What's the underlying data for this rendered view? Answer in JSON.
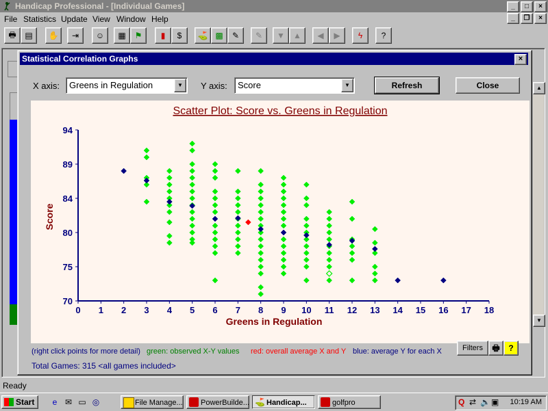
{
  "window": {
    "title": "Handicap Professional - [Individual Games]",
    "menu": [
      "File",
      "Statistics",
      "Update",
      "View",
      "Window",
      "Help"
    ],
    "toolbar_icons": [
      "printer-icon",
      "document-icon",
      "stop-hand-icon",
      "exit-icon",
      "handshake-icon",
      "calculator-icon",
      "flag-icon",
      "bar-chart-icon",
      "dollar-icon",
      "golfer-icon",
      "map-icon",
      "edit-icon",
      "disabled-icon",
      "down-arrow-icon",
      "up-arrow-icon",
      "left-arrow-icon",
      "right-arrow-icon",
      "lightning-icon",
      "help-icon"
    ]
  },
  "dialog": {
    "title": "Statistical Correlation Graphs",
    "x_axis_label": "X axis:",
    "x_axis_value": "Greens in Regulation",
    "y_axis_label": "Y axis:",
    "y_axis_value": "Score",
    "refresh_label": "Refresh",
    "close_label": "Close",
    "legend_hint": "(right click points for more detail)",
    "legend_green": "green: observed X-Y values",
    "legend_red": "red: overall average X and Y",
    "legend_blue": "blue: average Y for each X",
    "filters_label": "Filters",
    "total_games": "Total Games: 315  <all games included>"
  },
  "status_text": "Ready",
  "taskbar": {
    "start_label": "Start",
    "tasks": [
      "File Manage...",
      "PowerBuilde...",
      "Handicap...",
      "golfpro"
    ],
    "clock": "10:19 AM"
  },
  "colors": {
    "observed": "#00ee00",
    "overall_average": "#ff0000",
    "average_per_x": "#000080",
    "title": "#800000",
    "axis": "#000080"
  },
  "chart_data": {
    "type": "scatter",
    "title": "Scatter Plot: Score vs. Greens in Regulation",
    "xlabel": "Greens in Regulation",
    "ylabel": "Score",
    "xlim": [
      0,
      18
    ],
    "ylim": [
      70,
      94
    ],
    "x_ticks": [
      0,
      1,
      2,
      3,
      4,
      5,
      6,
      7,
      8,
      9,
      10,
      11,
      12,
      13,
      14,
      15,
      16,
      17,
      18
    ],
    "y_ticks": [
      70,
      75,
      80,
      84,
      89,
      94
    ],
    "y_tick_positions": [
      70,
      75,
      80,
      85,
      90,
      95
    ],
    "series": [
      {
        "name": "green: observed X-Y values",
        "points": [
          [
            3,
            92
          ],
          [
            3,
            91
          ],
          [
            3,
            88
          ],
          [
            3,
            87
          ],
          [
            3,
            84.5
          ],
          [
            4,
            89
          ],
          [
            4,
            88
          ],
          [
            4,
            87
          ],
          [
            4,
            86
          ],
          [
            4,
            85
          ],
          [
            4,
            84
          ],
          [
            4,
            83
          ],
          [
            4,
            81.5
          ],
          [
            4,
            79.5
          ],
          [
            4,
            78.5
          ],
          [
            5,
            93
          ],
          [
            5,
            92
          ],
          [
            5,
            90
          ],
          [
            5,
            89
          ],
          [
            5,
            88
          ],
          [
            5,
            87
          ],
          [
            5,
            86
          ],
          [
            5,
            85
          ],
          [
            5,
            84
          ],
          [
            5,
            83
          ],
          [
            5,
            82
          ],
          [
            5,
            81
          ],
          [
            5,
            80
          ],
          [
            5,
            79
          ],
          [
            5,
            78.5
          ],
          [
            6,
            90
          ],
          [
            6,
            89
          ],
          [
            6,
            88
          ],
          [
            6,
            86
          ],
          [
            6,
            85
          ],
          [
            6,
            84
          ],
          [
            6,
            83
          ],
          [
            6,
            81
          ],
          [
            6,
            80
          ],
          [
            6,
            79
          ],
          [
            6,
            78
          ],
          [
            6,
            77
          ],
          [
            6,
            73
          ],
          [
            7,
            89
          ],
          [
            7,
            86
          ],
          [
            7,
            85
          ],
          [
            7,
            84
          ],
          [
            7,
            83
          ],
          [
            7,
            82
          ],
          [
            7,
            81
          ],
          [
            7,
            80
          ],
          [
            7,
            79
          ],
          [
            7,
            78
          ],
          [
            7,
            77
          ],
          [
            8,
            89
          ],
          [
            8,
            87
          ],
          [
            8,
            86
          ],
          [
            8,
            85
          ],
          [
            8,
            84
          ],
          [
            8,
            83
          ],
          [
            8,
            82
          ],
          [
            8,
            81
          ],
          [
            8,
            80
          ],
          [
            8,
            79
          ],
          [
            8,
            78
          ],
          [
            8,
            77
          ],
          [
            8,
            76
          ],
          [
            8,
            75
          ],
          [
            8,
            74
          ],
          [
            8,
            72
          ],
          [
            8,
            71
          ],
          [
            9,
            88
          ],
          [
            9,
            87
          ],
          [
            9,
            86
          ],
          [
            9,
            85
          ],
          [
            9,
            84
          ],
          [
            9,
            83
          ],
          [
            9,
            82
          ],
          [
            9,
            81
          ],
          [
            9,
            80
          ],
          [
            9,
            79
          ],
          [
            9,
            78
          ],
          [
            9,
            77
          ],
          [
            9,
            76
          ],
          [
            9,
            75
          ],
          [
            9,
            74
          ],
          [
            10,
            87
          ],
          [
            10,
            85
          ],
          [
            10,
            84
          ],
          [
            10,
            82
          ],
          [
            10,
            81
          ],
          [
            10,
            80
          ],
          [
            10,
            79
          ],
          [
            10,
            78
          ],
          [
            10,
            77
          ],
          [
            10,
            76
          ],
          [
            10,
            75
          ],
          [
            10,
            73
          ],
          [
            11,
            83
          ],
          [
            11,
            82
          ],
          [
            11,
            81
          ],
          [
            11,
            80
          ],
          [
            11,
            79
          ],
          [
            11,
            78
          ],
          [
            11,
            77
          ],
          [
            11,
            76
          ],
          [
            11,
            75
          ],
          [
            11,
            74
          ],
          [
            11,
            73
          ],
          [
            12,
            84.5
          ],
          [
            12,
            82
          ],
          [
            12,
            79
          ],
          [
            12,
            78
          ],
          [
            12,
            77
          ],
          [
            12,
            76
          ],
          [
            12,
            73
          ],
          [
            13,
            80.5
          ],
          [
            13,
            78.5
          ],
          [
            13,
            77
          ],
          [
            13,
            75
          ],
          [
            13,
            74
          ],
          [
            13,
            73
          ]
        ]
      },
      {
        "name": "red: overall average X and Y",
        "points": [
          [
            7.45,
            81.5
          ]
        ]
      },
      {
        "name": "blue: average Y for each X",
        "points": [
          [
            2,
            89
          ],
          [
            3,
            87.6
          ],
          [
            4,
            84.5
          ],
          [
            5,
            83.9
          ],
          [
            6,
            82
          ],
          [
            7,
            82.1
          ],
          [
            8,
            80.5
          ],
          [
            9,
            80
          ],
          [
            10,
            79.6
          ],
          [
            11,
            78.2
          ],
          [
            12,
            78.8
          ],
          [
            13,
            77.6
          ],
          [
            14,
            73
          ],
          [
            16,
            73
          ]
        ]
      }
    ],
    "hollow_point": [
      11,
      74
    ]
  }
}
